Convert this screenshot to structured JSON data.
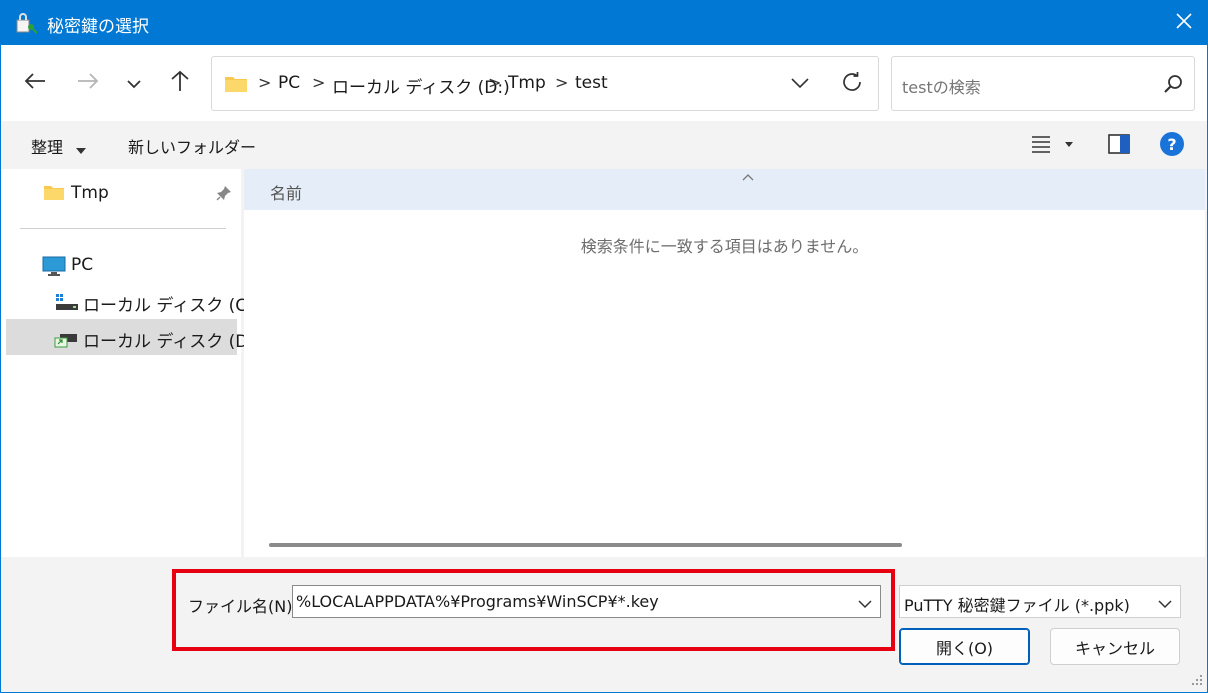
{
  "window": {
    "title": "秘密鍵の選択"
  },
  "address": {
    "crumbs": [
      "PC",
      "ローカル ディスク (D:)",
      "Tmp",
      "test"
    ],
    "separator": ">"
  },
  "search": {
    "placeholder": "testの検索"
  },
  "toolbar": {
    "organize": "整理",
    "new_folder": "新しいフォルダー"
  },
  "sidebar": {
    "quick": [
      {
        "label": "Tmp",
        "icon": "folder-icon"
      }
    ],
    "pc": {
      "label": "PC",
      "icon": "monitor-icon"
    },
    "drives": [
      {
        "label": "ローカル ディスク (C:)",
        "icon": "drive-icon"
      },
      {
        "label": "ローカル ディスク (D:)",
        "icon": "drive-icon",
        "selected": true
      }
    ]
  },
  "content": {
    "column_name": "名前",
    "empty_message": "検索条件に一致する項目はありません。"
  },
  "footer": {
    "filename_label": "ファイル名(N):",
    "filename_value": "%LOCALAPPDATA%¥Programs¥WinSCP¥*.key",
    "filetype": "PuTTY 秘密鍵ファイル (*.ppk)",
    "open_label": "開く(O)",
    "cancel_label": "キャンセル"
  },
  "colors": {
    "titlebar": "#0078d4",
    "highlight": "#e60012",
    "header": "#e5eef8",
    "accent": "#005fb8"
  }
}
